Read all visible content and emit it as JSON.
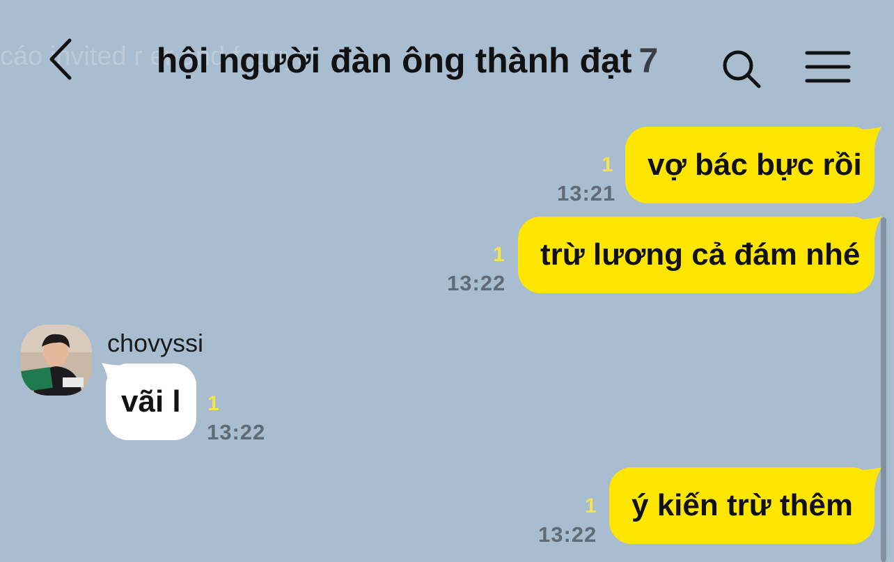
{
  "background_text": "cáo invited r                                                                er and f_guysi",
  "header": {
    "title": "hội người đàn ông thành đạt",
    "member_count": "7",
    "back_icon": "chevron-left-icon",
    "search_icon": "search-icon",
    "menu_icon": "hamburger-menu-icon"
  },
  "messages": [
    {
      "side": "me",
      "text": "vợ bác bực rồi",
      "unread": "1",
      "time": "13:21"
    },
    {
      "side": "me",
      "text": "trừ lương cả đám nhé",
      "unread": "1",
      "time": "13:22"
    },
    {
      "side": "them",
      "sender": "chovyssi",
      "text": "vãi l",
      "unread": "1",
      "time": "13:22"
    },
    {
      "side": "me",
      "text": "ý kiến trừ thêm",
      "unread": "1",
      "time": "13:22"
    }
  ],
  "colors": {
    "background": "#a9bdd0",
    "my_bubble": "#ffe600",
    "their_bubble": "#ffffff",
    "unread": "#f5e34a",
    "time": "#5f6b77"
  }
}
